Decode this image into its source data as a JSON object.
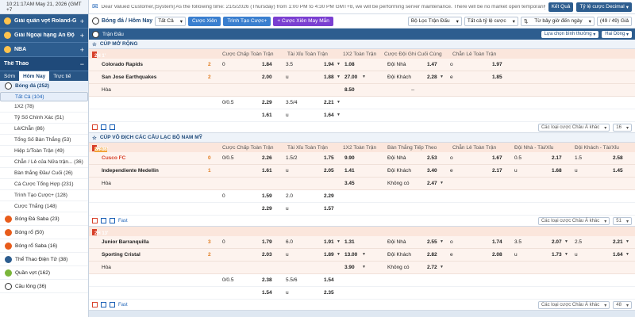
{
  "sidebar": {
    "timestamp": "10:21:17AM May 21, 2026 (GMT +7",
    "leagues": [
      {
        "name": "Giải quần vợt Roland-G..."
      },
      {
        "name": "Giải Ngoại hạng Ấn Độ"
      },
      {
        "name": "NBA"
      },
      {
        "name": "Thể Thao"
      }
    ],
    "tabs": [
      "Sớm",
      "Hôm Nay",
      "Trực tiế"
    ],
    "football": "Bóng đá (252)",
    "items": [
      {
        "label": "Tất Cả (104)"
      },
      {
        "label": "1X2 (78)"
      },
      {
        "label": "Tỷ Số Chính Xác (51)"
      },
      {
        "label": "Lẻ/Chẵn (86)"
      },
      {
        "label": "Tổng Số Bàn Thắng (53)"
      },
      {
        "label": "Hiệp 1/Toàn Trận (49)"
      },
      {
        "label": "Chẵn / Lẻ của Nửa trận... (36)"
      },
      {
        "label": "Bàn thắng Đầu/ Cuối (26)"
      },
      {
        "label": "Cá Cược Tổng Hợp (231)"
      },
      {
        "label": "Trình Tạo Cược+ (128)"
      },
      {
        "label": "Cược Thắng (148)"
      }
    ],
    "sports": [
      {
        "label": "Bóng Đá Saba (23)"
      },
      {
        "label": "Bóng rổ (50)"
      },
      {
        "label": "Bóng rổ Saba (16)"
      },
      {
        "label": "Thể Thao Điện Tử (38)"
      },
      {
        "label": "Quần vợt (162)"
      },
      {
        "label": "Cầu lông (36)"
      }
    ]
  },
  "notice": {
    "text": "Dear Valued Customer,[System] As the following time: 21/5/2026 (Thursday) from 1:00 PM to 4:30 PM GMT+8, we will be performing server maintenance. There will be no market open temporarily. Sorry for the inconvenience caused.",
    "result_btn": "Kết Quả",
    "odds_type": "Tỷ lệ cược Decimal"
  },
  "toolbar": {
    "title": "Bóng đá / Hôm Nay",
    "filter_all": "Tất Cả",
    "btn_parlay": "Cược Xiên",
    "btn_builder": "Trình Tạo Cược+",
    "btn_lucky": "Cược Xiên May Mắn",
    "match_filter": "Bộ Lọc Trận Đấu",
    "all_odds": "Tất cả tỷ lệ cược",
    "time_order": "Từ bây giờ đến ngày",
    "pages": "(49 / 49) Giả"
  },
  "sportbar": {
    "title": "Trận Đấu",
    "view": "Lựa chọn bình thường",
    "lines": "Hai Dòng"
  },
  "blocks": [
    {
      "league": "CÚP MỞ RỘNG",
      "badge": "2H 1'",
      "live_tag": "",
      "headers": [
        "Cược Chấp Toàn Trận",
        "Tài Xỉu Toàn Trận",
        "1X2 Toàn Trận",
        "Cược Đội Ghi Cuối Cùng",
        "Chẵn Lẻ Toàn Trận"
      ],
      "home": "Colorado Rapids",
      "home_score": "2",
      "away": "San Jose Earthquakes",
      "away_score": "2",
      "draw": "Hòa",
      "rows": [
        [
          "0",
          "1.84",
          "3.5",
          "1.94",
          "1.08",
          "Đội Nhà",
          "1.47",
          "o",
          "1.97"
        ],
        [
          "",
          "2.00",
          "u",
          "1.88",
          "27.00",
          "Đội Khách",
          "2.28",
          "e",
          "1.85"
        ],
        [
          "",
          "",
          "",
          "",
          "8.50",
          "",
          "--",
          "",
          ""
        ],
        [
          "0/0.5",
          "2.29",
          "3.5/4",
          "2.21",
          "",
          "",
          "",
          "",
          ""
        ],
        [
          "",
          "1.61",
          "u",
          "1.64",
          "",
          "",
          "",
          "",
          ""
        ]
      ],
      "footer_sel": "Các loại cược Châu Á khác",
      "footer_count": "16"
    },
    {
      "league": "CÚP VÔ ĐỊCH CÁC CÂU LẠC BỘ NAM MỸ",
      "badge": "2H 18'",
      "live_tag": "VAR",
      "headers": [
        "Cược Chấp Toàn Trận",
        "Tài Xỉu Toàn Trận",
        "1X2 Toàn Trận",
        "Bàn Thắng Tiếp Theo",
        "Chẵn Lẻ Toàn Trận",
        "Đội Nhà - Tài/Xỉu",
        "Đội Khách - Tài/Xỉu"
      ],
      "home": "Cusco FC",
      "home_score": "0",
      "away": "Independiente Medellin",
      "away_score": "1",
      "draw": "Hòa",
      "rows": [
        [
          "0/0.5",
          "2.26",
          "1.5/2",
          "1.75",
          "9.90",
          "Đội Nhà",
          "2.53",
          "o",
          "1.67",
          "0.5",
          "2.17",
          "1.5",
          "2.58"
        ],
        [
          "",
          "1.61",
          "u",
          "2.05",
          "1.41",
          "Đội Khách",
          "3.40",
          "e",
          "2.17",
          "u",
          "1.68",
          "u",
          "1.45"
        ],
        [
          "",
          "",
          "",
          "",
          "3.45",
          "Không có",
          "2.47",
          "",
          "",
          "",
          "",
          "",
          ""
        ],
        [
          "0",
          "1.59",
          "2.0",
          "2.29",
          "",
          "",
          "",
          "",
          "",
          "",
          "",
          "",
          ""
        ],
        [
          "",
          "2.29",
          "u",
          "1.57",
          "",
          "",
          "",
          "",
          "",
          "",
          "",
          "",
          ""
        ]
      ],
      "footer_sel": "Các loại cược Châu Á khác",
      "footer_count": "51",
      "fast": "Fast"
    },
    {
      "league": "",
      "badge": "2H 13'",
      "live_tag": "",
      "home": "Junior Barranquilla",
      "home_score": "3",
      "away": "Sporting Cristal",
      "away_score": "2",
      "draw": "Hòa",
      "rows": [
        [
          "0",
          "1.79",
          "6.0",
          "1.91",
          "1.31",
          "Đội Nhà",
          "2.55",
          "o",
          "1.74",
          "3.5",
          "2.07",
          "2.5",
          "2.21"
        ],
        [
          "",
          "2.03",
          "u",
          "1.89",
          "13.00",
          "Đội Khách",
          "2.82",
          "e",
          "2.08",
          "u",
          "1.73",
          "u",
          "1.64"
        ],
        [
          "",
          "",
          "",
          "",
          "3.90",
          "Không có",
          "2.72",
          "",
          "",
          "",
          "",
          "",
          ""
        ],
        [
          "0/0.5",
          "2.38",
          "5.5/6",
          "1.54",
          "",
          "",
          "",
          "",
          "",
          "",
          "",
          "",
          ""
        ],
        [
          "",
          "1.54",
          "u",
          "2.35",
          "",
          "",
          "",
          "",
          "",
          "",
          "",
          "",
          ""
        ]
      ],
      "footer_sel": "Các loại cược Châu Á khác",
      "footer_count": "48",
      "fast": "Fast"
    }
  ]
}
